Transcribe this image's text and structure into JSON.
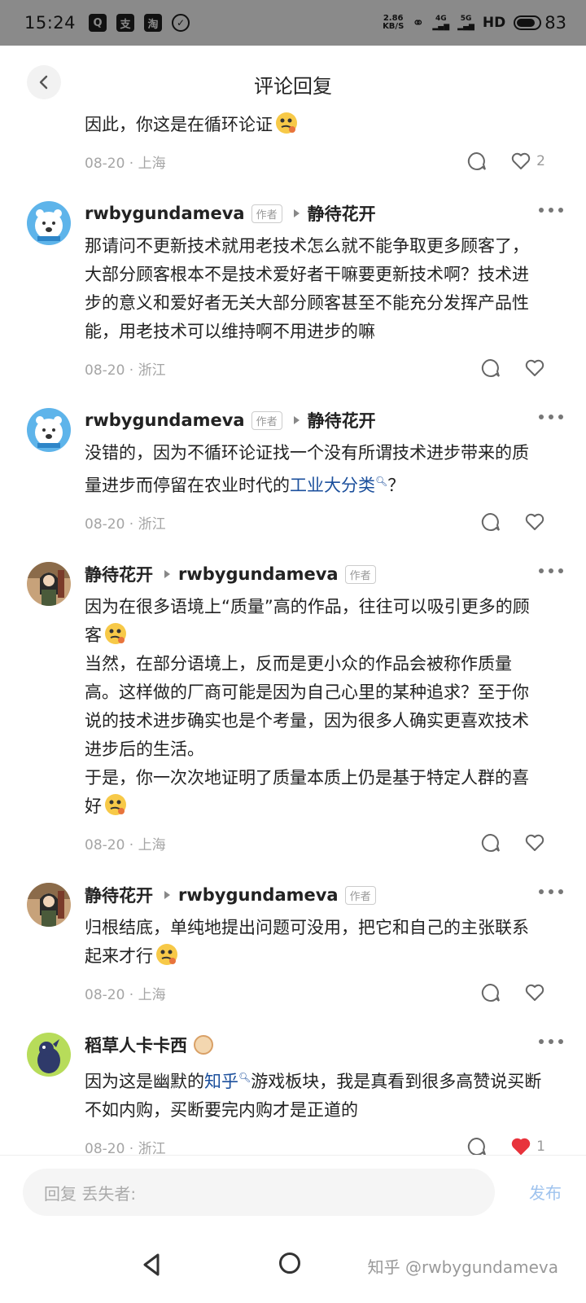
{
  "status_bar": {
    "time": "15:24",
    "app_icons": [
      "Q",
      "支",
      "淘"
    ],
    "speed_top": "2.86",
    "speed_bottom": "KB/S",
    "signal1": "4G",
    "signal2": "5G",
    "hd": "HD",
    "battery": "83",
    "battery_level": 0.83
  },
  "header": {
    "title": "评论回复"
  },
  "comments": [
    {
      "text": "因此，你这是在循环论证",
      "date": "08-20 · 上海",
      "like_count": "2"
    },
    {
      "author": "rwbygundameva",
      "author_tag": "作者",
      "reply_to": "静待花开",
      "text": "那请问不更新技术就用老技术怎么就不能争取更多顾客了，大部分顾客根本不是技术爱好者干嘛要更新技术啊？技术进步的意义和爱好者无关大部分顾客甚至不能充分发挥产品性能，用老技术可以维持啊不用进步的嘛",
      "date": "08-20 · 浙江"
    },
    {
      "author": "rwbygundameva",
      "author_tag": "作者",
      "reply_to": "静待花开",
      "text_before": "没错的，因为不循环论证找一个没有所谓技术进步带来的质量进步而停留在农业时代的",
      "link": "工业大分类",
      "text_after": "？",
      "date": "08-20 · 浙江"
    },
    {
      "author": "静待花开",
      "reply_to": "rwbygundameva",
      "reply_tag": "作者",
      "text1": "因为在很多语境上“质量”高的作品，往往可以吸引更多的顾客",
      "text2": "当然，在部分语境上，反而是更小众的作品会被称作质量高。这样做的厂商可能是因为自己心里的某种追求？至于你说的技术进步确实也是个考量，因为很多人确实更喜欢技术进步后的生活。",
      "text3": "于是，你一次次地证明了质量本质上仍是基于特定人群的喜好",
      "date": "08-20 · 上海"
    },
    {
      "author": "静待花开",
      "reply_to": "rwbygundameva",
      "reply_tag": "作者",
      "text": "归根结底，单纯地提出问题可没用，把它和自己的主张联系起来才行",
      "date": "08-20 · 上海"
    },
    {
      "author": "稻草人卡卡西",
      "text_before": "因为这是幽默的",
      "link": "知乎",
      "text_after": "游戏板块，我是真看到很多高赞说买断不如内购，买断要完内购才是正道的",
      "date": "08-20 · 浙江",
      "like_count": "1"
    }
  ],
  "input": {
    "placeholder": "回复 丢失者:",
    "send_label": "发布"
  },
  "watermark": "知乎 @rwbygundameva",
  "colors": {
    "link": "#1b4f9c",
    "like_active": "#e8333c",
    "send": "#9fc3ee"
  }
}
